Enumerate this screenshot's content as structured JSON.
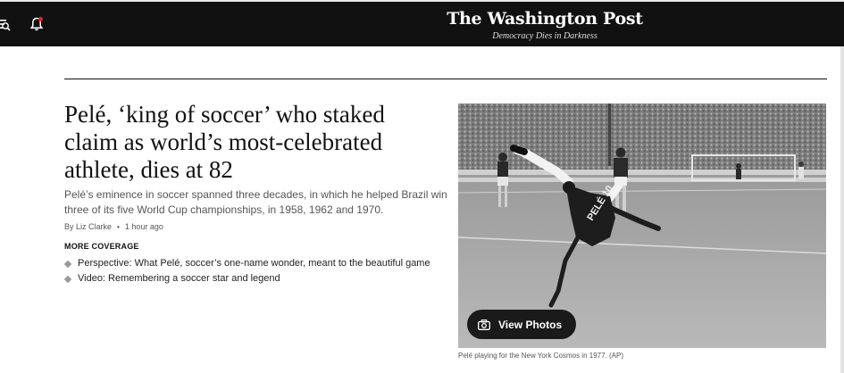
{
  "header": {
    "masthead_title": "The Washington Post",
    "masthead_tagline": "Democracy Dies in Darkness",
    "menu_icon": "menu-icon",
    "notification_icon": "bell-icon",
    "notification_dot_color": "#e0242d"
  },
  "article": {
    "headline": "Pelé, ‘king of soccer’ who staked claim as world’s most-celebrated athlete, dies at 82",
    "blurb": "Pelé’s eminence in soccer spanned three decades, in which he helped Brazil win three of its five World Cup championships, in 1958, 1962 and 1970.",
    "byline": "By Liz Clarke",
    "timestamp": "1 hour ago"
  },
  "more_coverage": {
    "label": "MORE COVERAGE",
    "items": [
      {
        "text": "Perspective: What Pelé, soccer’s one-name wonder, meant to the beautiful game"
      },
      {
        "text": "Video: Remembering a soccer star and legend"
      }
    ]
  },
  "photo": {
    "view_button": "View Photos",
    "button_icon": "camera-icon",
    "caption": "Pelé playing for the New York Cosmos in 1977. (AP)",
    "jersey_text": "PELÉ 10"
  },
  "colors": {
    "topbar": "#111111",
    "text_primary": "#111111",
    "text_secondary": "#555555"
  }
}
